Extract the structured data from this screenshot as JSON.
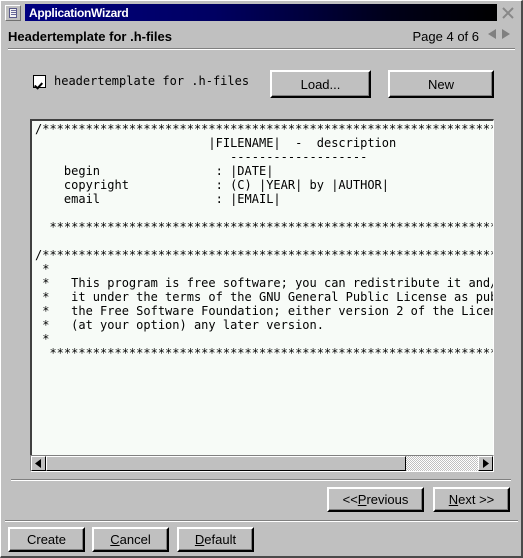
{
  "window": {
    "title": "ApplicationWizard",
    "sysmenu_icon": "document-icon",
    "close_icon": "close-x-icon"
  },
  "header": {
    "page_title": "Headertemplate for .h-files",
    "page_count": "Page 4 of 6",
    "prev_arrow_icon": "triangle-left-icon",
    "next_arrow_icon": "triangle-right-icon"
  },
  "controls": {
    "checkbox_label": "headertemplate for .h-files",
    "checkbox_checked": true,
    "load_label": "Load...",
    "new_label": "New"
  },
  "editor": {
    "content": "/*******************************************************************************\n                        |FILENAME|  -  description\n                           -------------------\n    begin                : |DATE|\n    copyright            : (C) |YEAR| by |AUTHOR|\n    email                : |EMAIL|\n\n  *****************************************************************************\n\n/*******************************************************************************\n *\n *   This program is free software; you can redistribute it and/or\n *   it under the terms of the GNU General Public License as publ\n *   the Free Software Foundation; either version 2 of the Licens\n *   (at your option) any later version.\n *\n  *****************************************************************************",
    "hscroll": {
      "left_arrow_icon": "scroll-left-arrow-icon",
      "right_arrow_icon": "scroll-right-arrow-icon",
      "thumb_position_pct": 0
    }
  },
  "navigation": {
    "previous_prefix": "<< ",
    "previous_mnemonic": "P",
    "previous_suffix": "revious",
    "next_mnemonic": "N",
    "next_suffix": "ext >>"
  },
  "footer": {
    "create_label": "Create",
    "cancel_mnemonic": "C",
    "cancel_suffix": "ancel",
    "default_mnemonic": "D",
    "default_suffix": "efault"
  },
  "colors": {
    "face": "#c0c0c0",
    "title_active": "#000080",
    "editor_bg": "#f7fbf7",
    "text": "#000000"
  }
}
